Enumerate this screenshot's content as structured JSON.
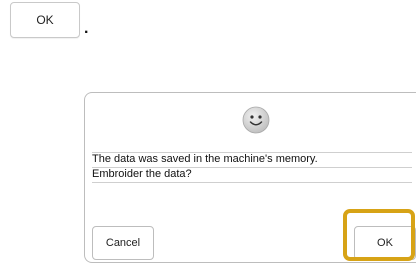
{
  "instruction": {
    "ok_button_label": "OK",
    "trailing_punctuation": "."
  },
  "dialog": {
    "icon": "smiley-face-icon",
    "message_line_1": "The data was saved in the machine's memory.",
    "message_line_2": "Embroider the data?",
    "cancel_label": "Cancel",
    "ok_label": "OK"
  },
  "colors": {
    "highlight": "#d7a316"
  }
}
